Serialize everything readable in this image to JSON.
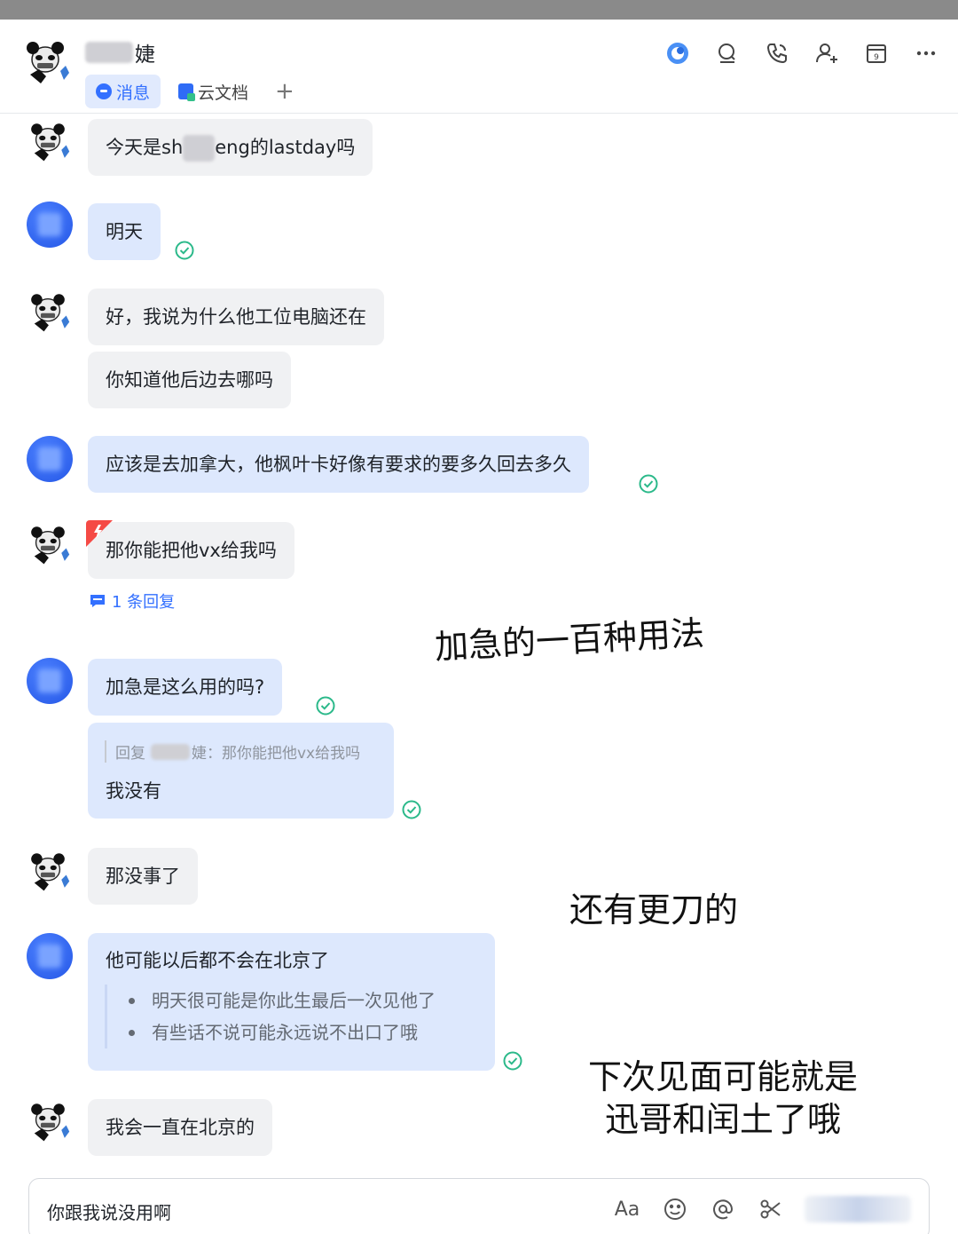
{
  "chat": {
    "title_suffix": "婕",
    "tabs": [
      {
        "label": "消息",
        "active": true
      },
      {
        "label": "云文档",
        "active": false
      }
    ],
    "add_tab": "+",
    "header_icons": [
      "ai-assistant-icon",
      "search-icon",
      "phone-call-icon",
      "add-member-icon",
      "calendar-icon",
      "more-icon"
    ],
    "calendar_number": "9"
  },
  "messages": [
    {
      "sender": "other",
      "text_a": "今天是sh",
      "text_b": "eng的lastday吗"
    },
    {
      "sender": "self",
      "text": "明天",
      "read": true
    },
    {
      "sender": "other",
      "text": "好，我说为什么他工位电脑还在"
    },
    {
      "sender": "other",
      "text": "你知道他后边去哪吗"
    },
    {
      "sender": "self",
      "text": "应该是去加拿大，他枫叶卡好像有要求的要多久回去多久",
      "read": true
    },
    {
      "sender": "other",
      "text": "那你能把他vx给我吗",
      "urgent": true
    },
    {
      "sender": "self",
      "text": "加急是这么用的吗?",
      "read": true
    },
    {
      "sender": "self",
      "quote_prefix": "回复",
      "quote_text": "婕：那你能把他vx给我吗",
      "text": "我没有",
      "read": true
    },
    {
      "sender": "other",
      "text": "那没事了"
    },
    {
      "sender": "self",
      "text": "他可能以后都不会在北京了",
      "list": [
        "明天很可能是你此生最后一次见他了",
        "有些话不说可能永远说不出口了哦"
      ],
      "read": true
    },
    {
      "sender": "other",
      "text": "我会一直在北京的"
    }
  ],
  "reply_count": "1 条回复",
  "annotations": {
    "first": "加急的一百种用法",
    "second": "还有更刀的",
    "third_line1": "下次见面可能就是",
    "third_line2": "迅哥和闰土了哦"
  },
  "input": {
    "value": "你跟我说没用啊",
    "tools": [
      "format-icon",
      "emoji-icon",
      "mention-icon",
      "scissors-icon"
    ],
    "format_label": "Aa"
  },
  "colors": {
    "accent": "#3370ff",
    "self_bubble": "#dde8fd",
    "other_bubble": "#f0f1f3",
    "read_check": "#2bb98a",
    "urgent": "#f54a45"
  }
}
